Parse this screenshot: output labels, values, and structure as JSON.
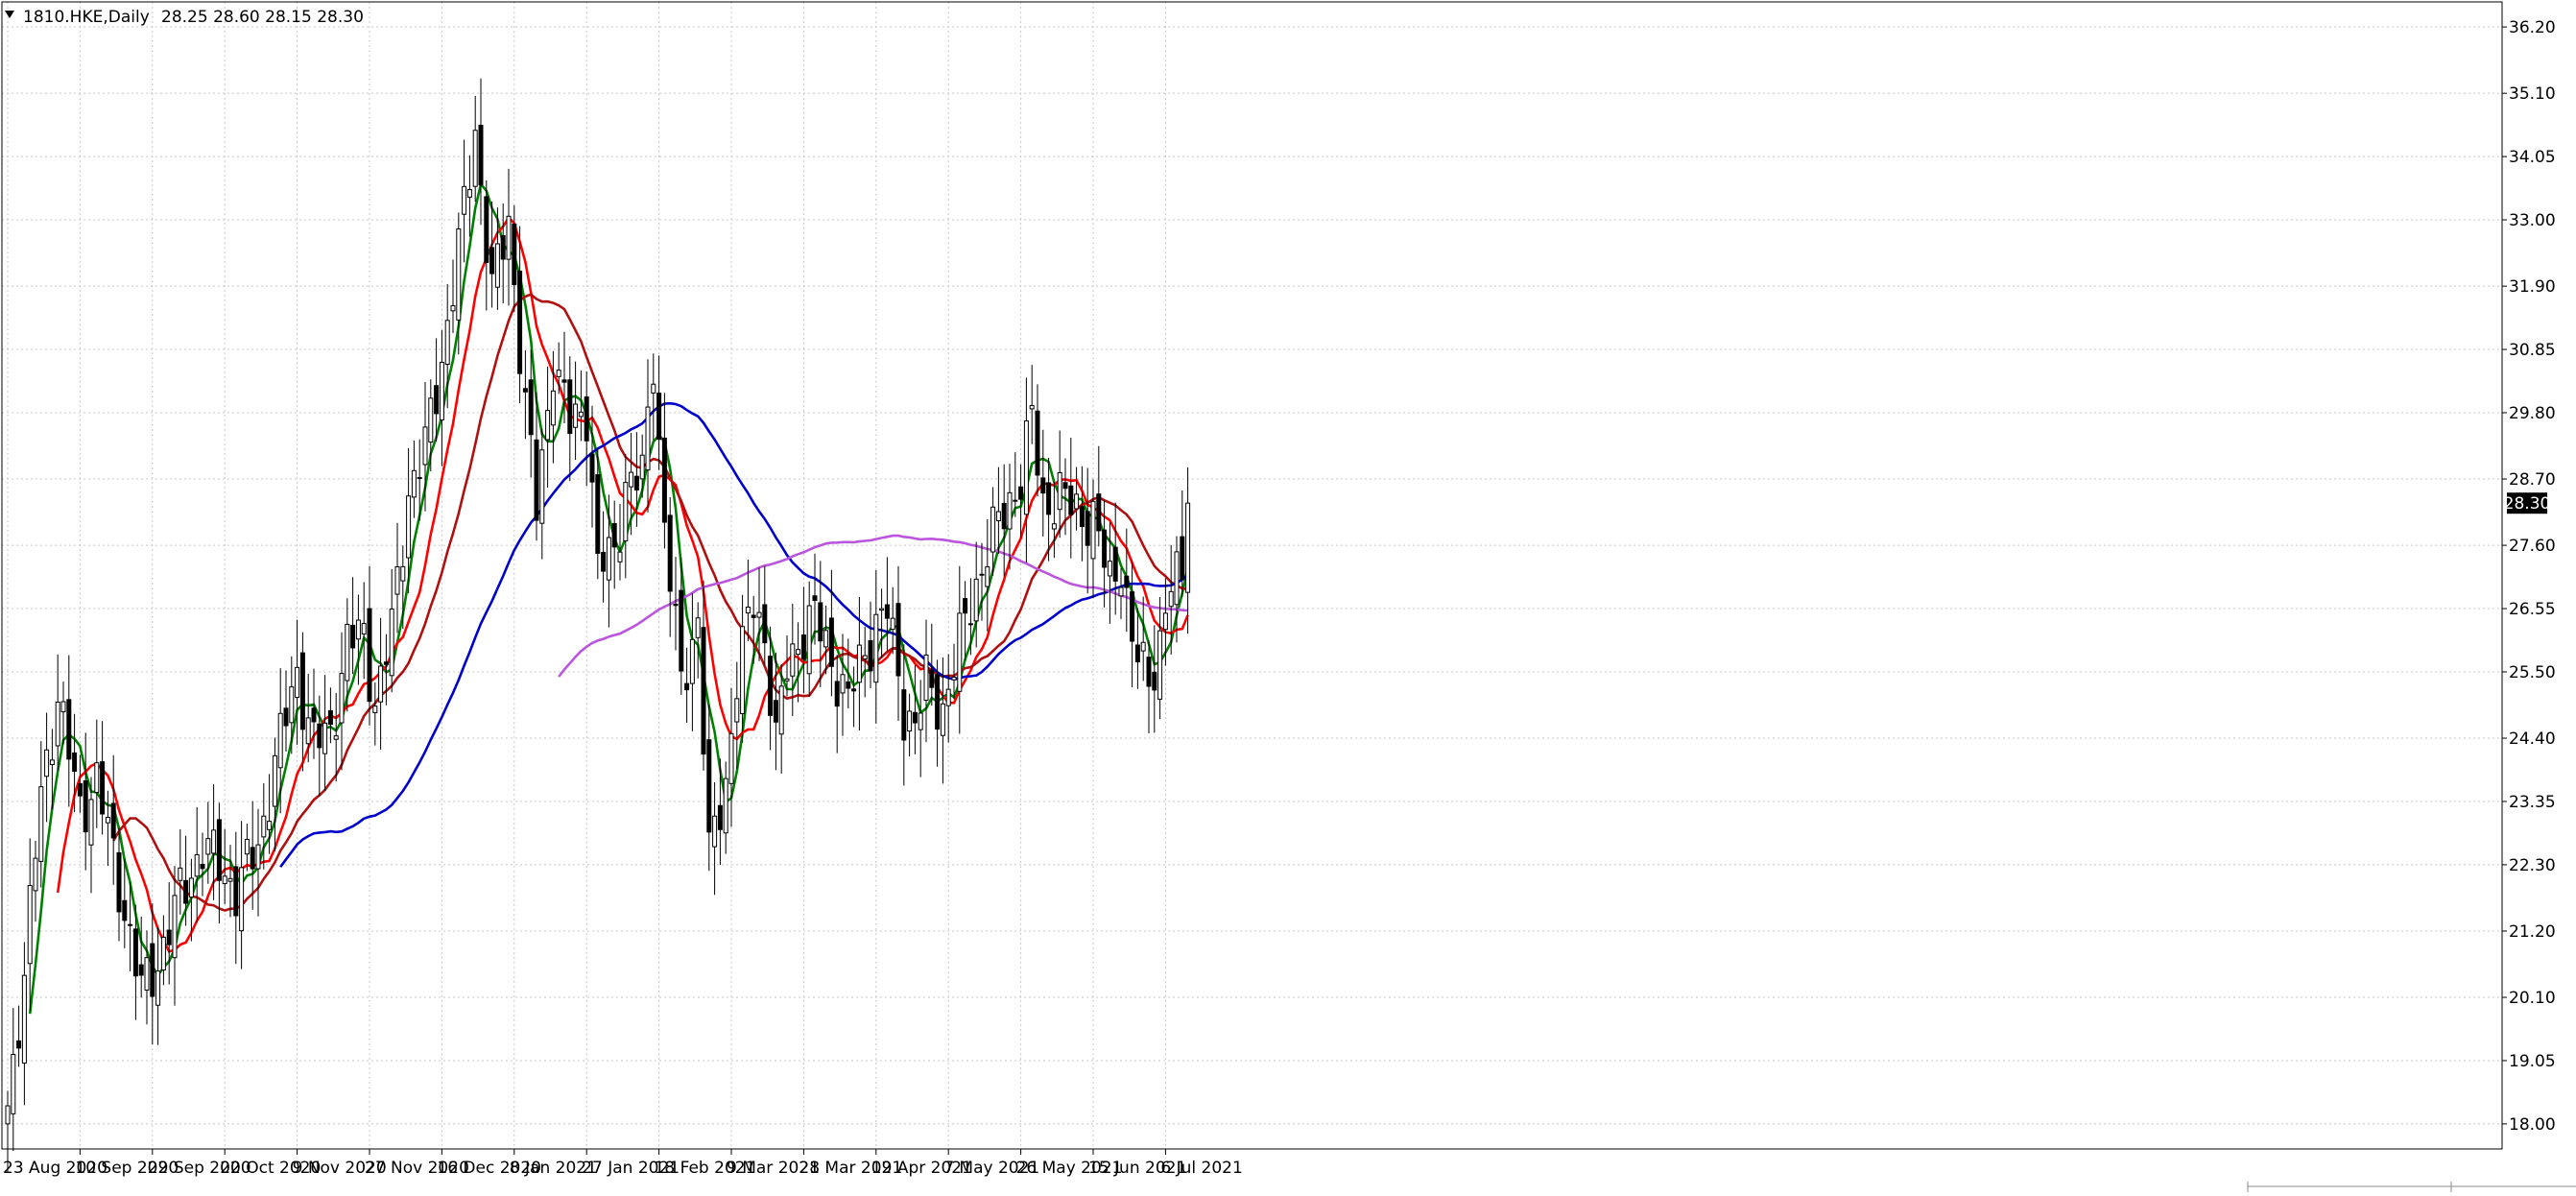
{
  "header": {
    "symbol_timeframe": "1810.HKE,Daily",
    "ohlc": "28.25 28.60 28.15 28.30",
    "menu_icon": "triangle-down-icon"
  },
  "colors": {
    "background": "#ffffff",
    "grid": "#c8c8c8",
    "candle_body_up": "#ffffff",
    "candle_body_down": "#000000",
    "candle_outline": "#000000",
    "price_label_bg": "#000000",
    "price_label_fg": "#ffffff",
    "ma_green": "#008000",
    "ma_red": "#ff0000",
    "ma_darkred": "#b01010",
    "ma_blue": "#0000cc",
    "ma_violet": "#bb55dd"
  },
  "chart_data": {
    "type": "candlestick",
    "symbol": "1810.HKE",
    "timeframe": "Daily",
    "last_price": "28.30",
    "grid": true,
    "y_axis_position": "right",
    "ylim": [
      17.6,
      36.6
    ],
    "y_ticks": [
      "36.20",
      "35.10",
      "34.05",
      "33.00",
      "31.90",
      "30.85",
      "29.80",
      "28.70",
      "27.60",
      "26.55",
      "25.50",
      "24.40",
      "23.35",
      "22.30",
      "21.20",
      "20.10",
      "19.05",
      "18.00"
    ],
    "x_ticks": [
      "23 Aug 2020",
      "10 Sep 2020",
      "29 Sep 2020",
      "20 Oct 2020",
      "9 Nov 2020",
      "27 Nov 2020",
      "16 Dec 2020",
      "8 Jan 2021",
      "27 Jan 2021",
      "18 Feb 2021",
      "9 Mar 2021",
      "28 Mar 2021",
      "19 Apr 2021",
      "7 May 2021",
      "26 May 2021",
      "15 Jun 2021",
      "6 Jul 2021"
    ],
    "x_tick_bar_index": [
      0,
      13,
      26,
      39,
      52,
      65,
      78,
      91,
      104,
      117,
      130,
      143,
      156,
      169,
      182,
      195,
      208
    ],
    "bar_count": 213,
    "price_anchors": [
      [
        0,
        18.3
      ],
      [
        3,
        20.5
      ],
      [
        6,
        23.5
      ],
      [
        9,
        25.1
      ],
      [
        13,
        23.2
      ],
      [
        16,
        23.7
      ],
      [
        20,
        22.0
      ],
      [
        24,
        20.2
      ],
      [
        27,
        20.7
      ],
      [
        31,
        21.8
      ],
      [
        35,
        22.6
      ],
      [
        38,
        22.3
      ],
      [
        41,
        21.9
      ],
      [
        45,
        22.6
      ],
      [
        48,
        24.0
      ],
      [
        52,
        25.5
      ],
      [
        55,
        24.3
      ],
      [
        58,
        24.5
      ],
      [
        61,
        26.0
      ],
      [
        64,
        26.1
      ],
      [
        66,
        25.0
      ],
      [
        69,
        26.2
      ],
      [
        72,
        28.5
      ],
      [
        75,
        29.2
      ],
      [
        78,
        30.7
      ],
      [
        81,
        32.5
      ],
      [
        84,
        34.5
      ],
      [
        87,
        31.8
      ],
      [
        90,
        33.0
      ],
      [
        93,
        29.9
      ],
      [
        95,
        28.2
      ],
      [
        98,
        30.7
      ],
      [
        101,
        29.6
      ],
      [
        104,
        29.9
      ],
      [
        106,
        27.2
      ],
      [
        109,
        27.5
      ],
      [
        111,
        28.6
      ],
      [
        114,
        28.7
      ],
      [
        116,
        30.8
      ],
      [
        118,
        27.9
      ],
      [
        121,
        25.3
      ],
      [
        124,
        26.4
      ],
      [
        126,
        22.4
      ],
      [
        129,
        23.7
      ],
      [
        131,
        25.4
      ],
      [
        134,
        26.7
      ],
      [
        136,
        26.1
      ],
      [
        138,
        24.3
      ],
      [
        140,
        25.6
      ],
      [
        143,
        26.2
      ],
      [
        145,
        26.4
      ],
      [
        148,
        25.7
      ],
      [
        151,
        25.0
      ],
      [
        153,
        25.6
      ],
      [
        156,
        26.3
      ],
      [
        158,
        26.5
      ],
      [
        161,
        24.9
      ],
      [
        163,
        24.6
      ],
      [
        165,
        25.3
      ],
      [
        168,
        24.9
      ],
      [
        170,
        25.6
      ],
      [
        173,
        26.7
      ],
      [
        176,
        27.5
      ],
      [
        179,
        28.2
      ],
      [
        182,
        28.7
      ],
      [
        184,
        29.7
      ],
      [
        186,
        28.3
      ],
      [
        189,
        28.4
      ],
      [
        192,
        28.2
      ],
      [
        195,
        28.0
      ],
      [
        198,
        27.0
      ],
      [
        200,
        27.4
      ],
      [
        202,
        25.9
      ],
      [
        205,
        25.4
      ],
      [
        207,
        26.0
      ],
      [
        209,
        26.9
      ],
      [
        211,
        27.1
      ],
      [
        212,
        28.3
      ]
    ],
    "moving_averages": [
      {
        "color": "#008000",
        "period": 5
      },
      {
        "color": "#ff0000",
        "period": 10
      },
      {
        "color": "#b01010",
        "period": 20
      },
      {
        "color": "#0000cc",
        "period": 50
      },
      {
        "color": "#bb55dd",
        "period": 100
      }
    ]
  }
}
